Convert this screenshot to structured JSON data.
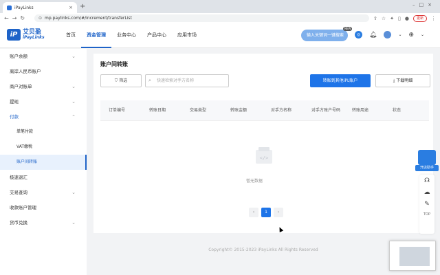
{
  "browser": {
    "tab_title": "iPayLinks",
    "url": "mp.paylinks.com/#/increment/transferList",
    "update_label": "更新"
  },
  "brand": {
    "cn": "艾贝盈",
    "en": "iPayLinks",
    "mark": "iP"
  },
  "topnav": [
    {
      "label": "首页"
    },
    {
      "label": "资金管理"
    },
    {
      "label": "业务中心"
    },
    {
      "label": "产品中心"
    },
    {
      "label": "应用市场"
    }
  ],
  "search_pill": "输入关键词一键搜索",
  "new_badge": "NEW",
  "sidebar": {
    "items": [
      {
        "label": "账户余额",
        "arrow": "⌄"
      },
      {
        "label": "离岸人民币账户",
        "arrow": ""
      },
      {
        "label": "商户对账单",
        "arrow": "⌄"
      },
      {
        "label": "提现",
        "arrow": "⌄"
      },
      {
        "label": "付款",
        "arrow": "⌃"
      },
      {
        "label": "单笔付款",
        "arrow": ""
      },
      {
        "label": "VAT缴税",
        "arrow": ""
      },
      {
        "label": "账户间转账",
        "arrow": ""
      },
      {
        "label": "极速退汇",
        "arrow": ""
      },
      {
        "label": "交易查询",
        "arrow": "⌄"
      },
      {
        "label": "收款账户管理",
        "arrow": ""
      },
      {
        "label": "货币兑换",
        "arrow": "⌄"
      }
    ]
  },
  "main": {
    "title": "账户间转账",
    "filter_label": "筛选",
    "search_placeholder": "快速检索对手方名称",
    "transfer_button": "转账到其他iPL账户",
    "download_button": "下载明细",
    "columns": [
      "订单编号",
      "转账日期",
      "交易类型",
      "转账金额",
      "对手方名称",
      "对手方账户号码",
      "转账用途",
      "状态"
    ],
    "empty_text": "暂无数据",
    "pager": {
      "prev": "‹",
      "current": "1",
      "next": "›"
    }
  },
  "footer": "Copyright© 2015-2023 iPayLinks All Rights Reserved",
  "float": {
    "bot_label": "开店助手",
    "top_label": "TOP"
  },
  "colors": {
    "primary": "#1e74e8",
    "brand": "#1e63c8"
  }
}
